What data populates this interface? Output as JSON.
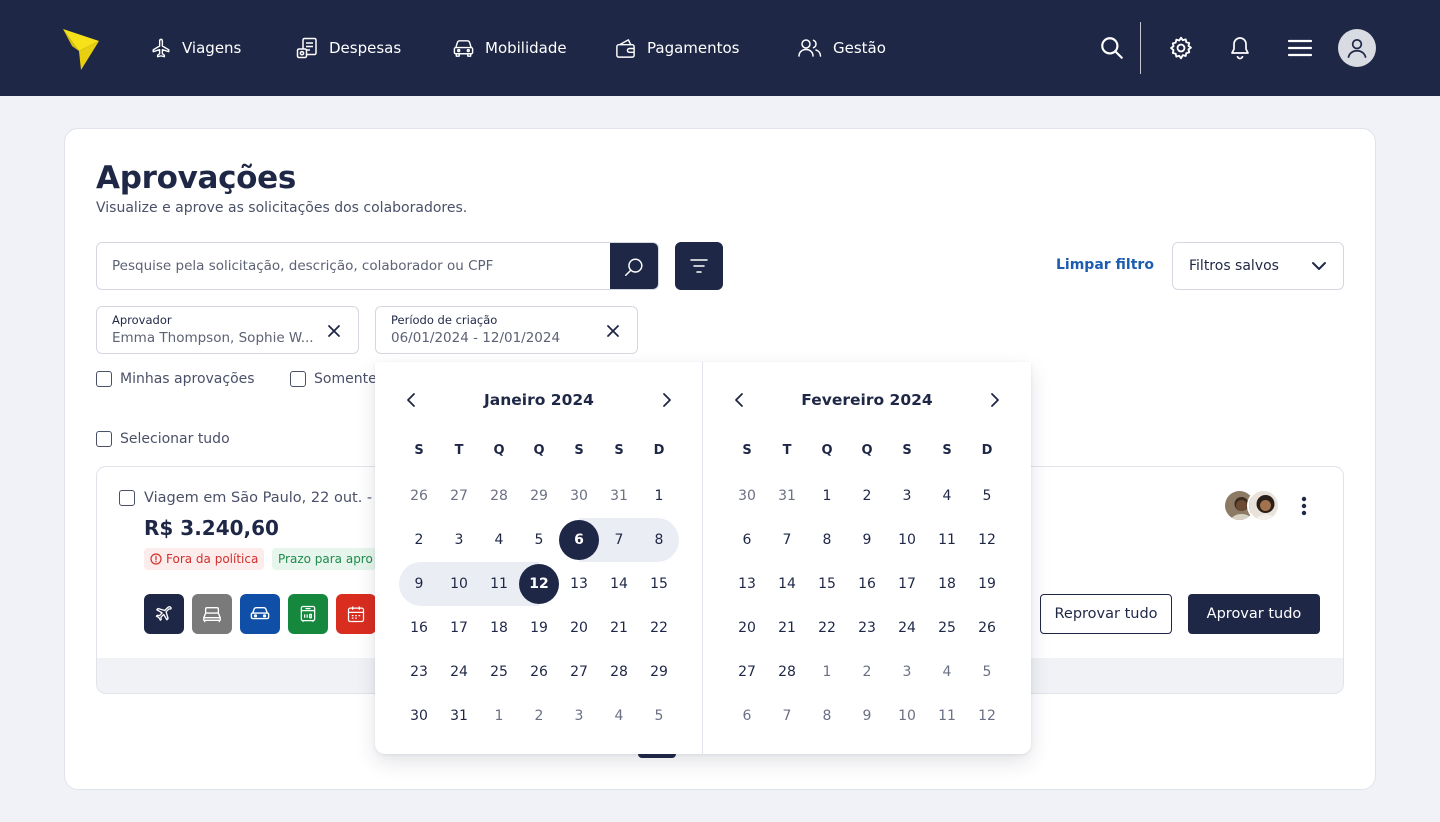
{
  "nav": {
    "items": [
      {
        "label": "Viagens",
        "icon": "airplane-icon"
      },
      {
        "label": "Despesas",
        "icon": "receipt-icon"
      },
      {
        "label": "Mobilidade",
        "icon": "car-icon"
      },
      {
        "label": "Pagamentos",
        "icon": "wallet-icon"
      },
      {
        "label": "Gestão",
        "icon": "users-icon"
      }
    ],
    "right_icons": [
      "search-icon",
      "gear-icon",
      "bell-icon",
      "menu-icon",
      "avatar-icon"
    ]
  },
  "page": {
    "title": "Aprovações",
    "subtitle": "Visualize e aprove as solicitações dos colaboradores."
  },
  "search": {
    "placeholder": "Pesquise pela solicitação, descrição, colaborador ou CPF",
    "value": ""
  },
  "filters": {
    "clear_label": "Limpar filtro",
    "saved_label": "Filtros salvos",
    "chips": [
      {
        "label": "Aprovador",
        "value": "Emma Thompson, Sophie W..."
      },
      {
        "label": "Período de criação",
        "value": "06/01/2024 - 12/01/2024"
      }
    ],
    "checkboxes": [
      {
        "label": "Minhas aprovações",
        "checked": false
      },
      {
        "label": "Somente",
        "checked": false
      }
    ],
    "select_all": {
      "label": "Selecionar tudo",
      "checked": false
    }
  },
  "request": {
    "title": "Viagem em São Paulo, 22 out. - 2",
    "amount": "R$ 3.240,60",
    "tags": [
      {
        "label": "Fora da política",
        "tone": "danger"
      },
      {
        "label": "Prazo para apro",
        "tone": "success"
      }
    ],
    "services": [
      {
        "icon": "airplane-icon",
        "color": "#1F2747"
      },
      {
        "icon": "bed-icon",
        "color": "#7A7A7A"
      },
      {
        "icon": "car-icon",
        "color": "#0F4FA8"
      },
      {
        "icon": "bus-icon",
        "color": "#15883E"
      },
      {
        "icon": "calendar-icon",
        "color": "#D92D20"
      }
    ],
    "reject_label": "Reprovar tudo",
    "approve_label": "Aprovar tudo"
  },
  "datepicker": {
    "weekdays": [
      "S",
      "T",
      "Q",
      "Q",
      "S",
      "S",
      "D"
    ],
    "months": [
      {
        "title": "Janeiro 2024",
        "weeks": [
          [
            {
              "d": "26",
              "out": true
            },
            {
              "d": "27",
              "out": true
            },
            {
              "d": "28",
              "out": true
            },
            {
              "d": "29",
              "out": true
            },
            {
              "d": "30",
              "out": true
            },
            {
              "d": "31",
              "out": true
            },
            {
              "d": "1"
            }
          ],
          [
            {
              "d": "2"
            },
            {
              "d": "3"
            },
            {
              "d": "4"
            },
            {
              "d": "5"
            },
            {
              "d": "6",
              "state": "start"
            },
            {
              "d": "7",
              "state": "range"
            },
            {
              "d": "8",
              "state": "range"
            }
          ],
          [
            {
              "d": "9",
              "state": "range"
            },
            {
              "d": "10",
              "state": "range"
            },
            {
              "d": "11",
              "state": "range"
            },
            {
              "d": "12",
              "state": "end"
            },
            {
              "d": "13"
            },
            {
              "d": "14"
            },
            {
              "d": "15"
            }
          ],
          [
            {
              "d": "16"
            },
            {
              "d": "17"
            },
            {
              "d": "18"
            },
            {
              "d": "19"
            },
            {
              "d": "20"
            },
            {
              "d": "21"
            },
            {
              "d": "22"
            }
          ],
          [
            {
              "d": "23"
            },
            {
              "d": "24"
            },
            {
              "d": "25"
            },
            {
              "d": "26"
            },
            {
              "d": "27"
            },
            {
              "d": "28"
            },
            {
              "d": "29"
            }
          ],
          [
            {
              "d": "30"
            },
            {
              "d": "31"
            },
            {
              "d": "1",
              "out": true
            },
            {
              "d": "2",
              "out": true
            },
            {
              "d": "3",
              "out": true
            },
            {
              "d": "4",
              "out": true
            },
            {
              "d": "5",
              "out": true
            }
          ]
        ]
      },
      {
        "title": "Fevereiro 2024",
        "weeks": [
          [
            {
              "d": "30",
              "out": true
            },
            {
              "d": "31",
              "out": true
            },
            {
              "d": "1"
            },
            {
              "d": "2"
            },
            {
              "d": "3"
            },
            {
              "d": "4"
            },
            {
              "d": "5"
            }
          ],
          [
            {
              "d": "6"
            },
            {
              "d": "7"
            },
            {
              "d": "8"
            },
            {
              "d": "9"
            },
            {
              "d": "10"
            },
            {
              "d": "11"
            },
            {
              "d": "12"
            }
          ],
          [
            {
              "d": "13"
            },
            {
              "d": "14"
            },
            {
              "d": "15"
            },
            {
              "d": "16"
            },
            {
              "d": "17"
            },
            {
              "d": "18"
            },
            {
              "d": "19"
            }
          ],
          [
            {
              "d": "20"
            },
            {
              "d": "21"
            },
            {
              "d": "22"
            },
            {
              "d": "23"
            },
            {
              "d": "24"
            },
            {
              "d": "25"
            },
            {
              "d": "26"
            }
          ],
          [
            {
              "d": "27"
            },
            {
              "d": "28"
            },
            {
              "d": "1",
              "out": true
            },
            {
              "d": "2",
              "out": true
            },
            {
              "d": "3",
              "out": true
            },
            {
              "d": "4",
              "out": true
            },
            {
              "d": "5",
              "out": true
            }
          ],
          [
            {
              "d": "6",
              "out": true
            },
            {
              "d": "7",
              "out": true
            },
            {
              "d": "8",
              "out": true
            },
            {
              "d": "9",
              "out": true
            },
            {
              "d": "10",
              "out": true
            },
            {
              "d": "11",
              "out": true
            },
            {
              "d": "12",
              "out": true
            }
          ]
        ]
      }
    ]
  },
  "colors": {
    "navy": "#1F2747",
    "link": "#1D5DB0",
    "logo": "#F7E11B",
    "range": "#EBEDF4"
  }
}
